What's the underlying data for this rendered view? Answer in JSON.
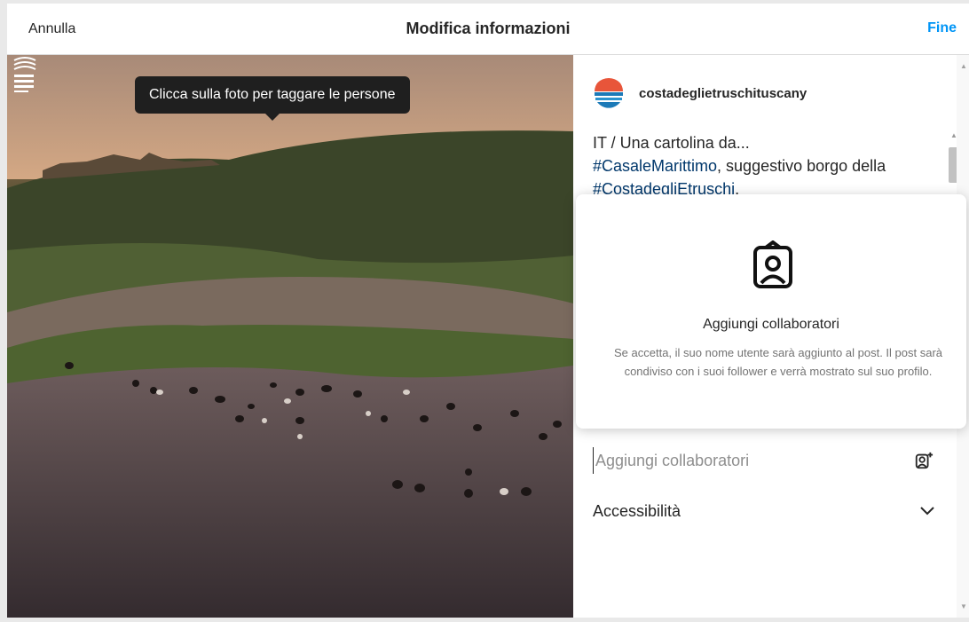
{
  "header": {
    "cancel_label": "Annulla",
    "title": "Modifica informazioni",
    "done_label": "Fine"
  },
  "photo": {
    "tooltip": "Clicca sulla foto per taggare le persone"
  },
  "post": {
    "username": "costadeglietruschituscany",
    "caption_prefix": "IT / Una cartolina da...",
    "hashtag_1": "#CasaleMarittimo",
    "caption_mid": ", suggestivo borgo della ",
    "hashtag_2": "#CostadegliEtruschi",
    "caption_end": "."
  },
  "popup": {
    "title": "Aggiungi collaboratori",
    "description": "Se accetta, il suo nome utente sarà aggiunto al post. Il post sarà condiviso con i suoi follower e verrà mostrato sul suo profilo."
  },
  "collaborators": {
    "placeholder": "Aggiungi collaboratori"
  },
  "accessibility": {
    "label": "Accessibilità"
  },
  "colors": {
    "accent": "#0095f6",
    "hashtag": "#00376b",
    "tooltip_bg": "#1f1f1f"
  },
  "icons": [
    "collaborator-icon",
    "add-user-icon",
    "chevron-down-icon"
  ]
}
